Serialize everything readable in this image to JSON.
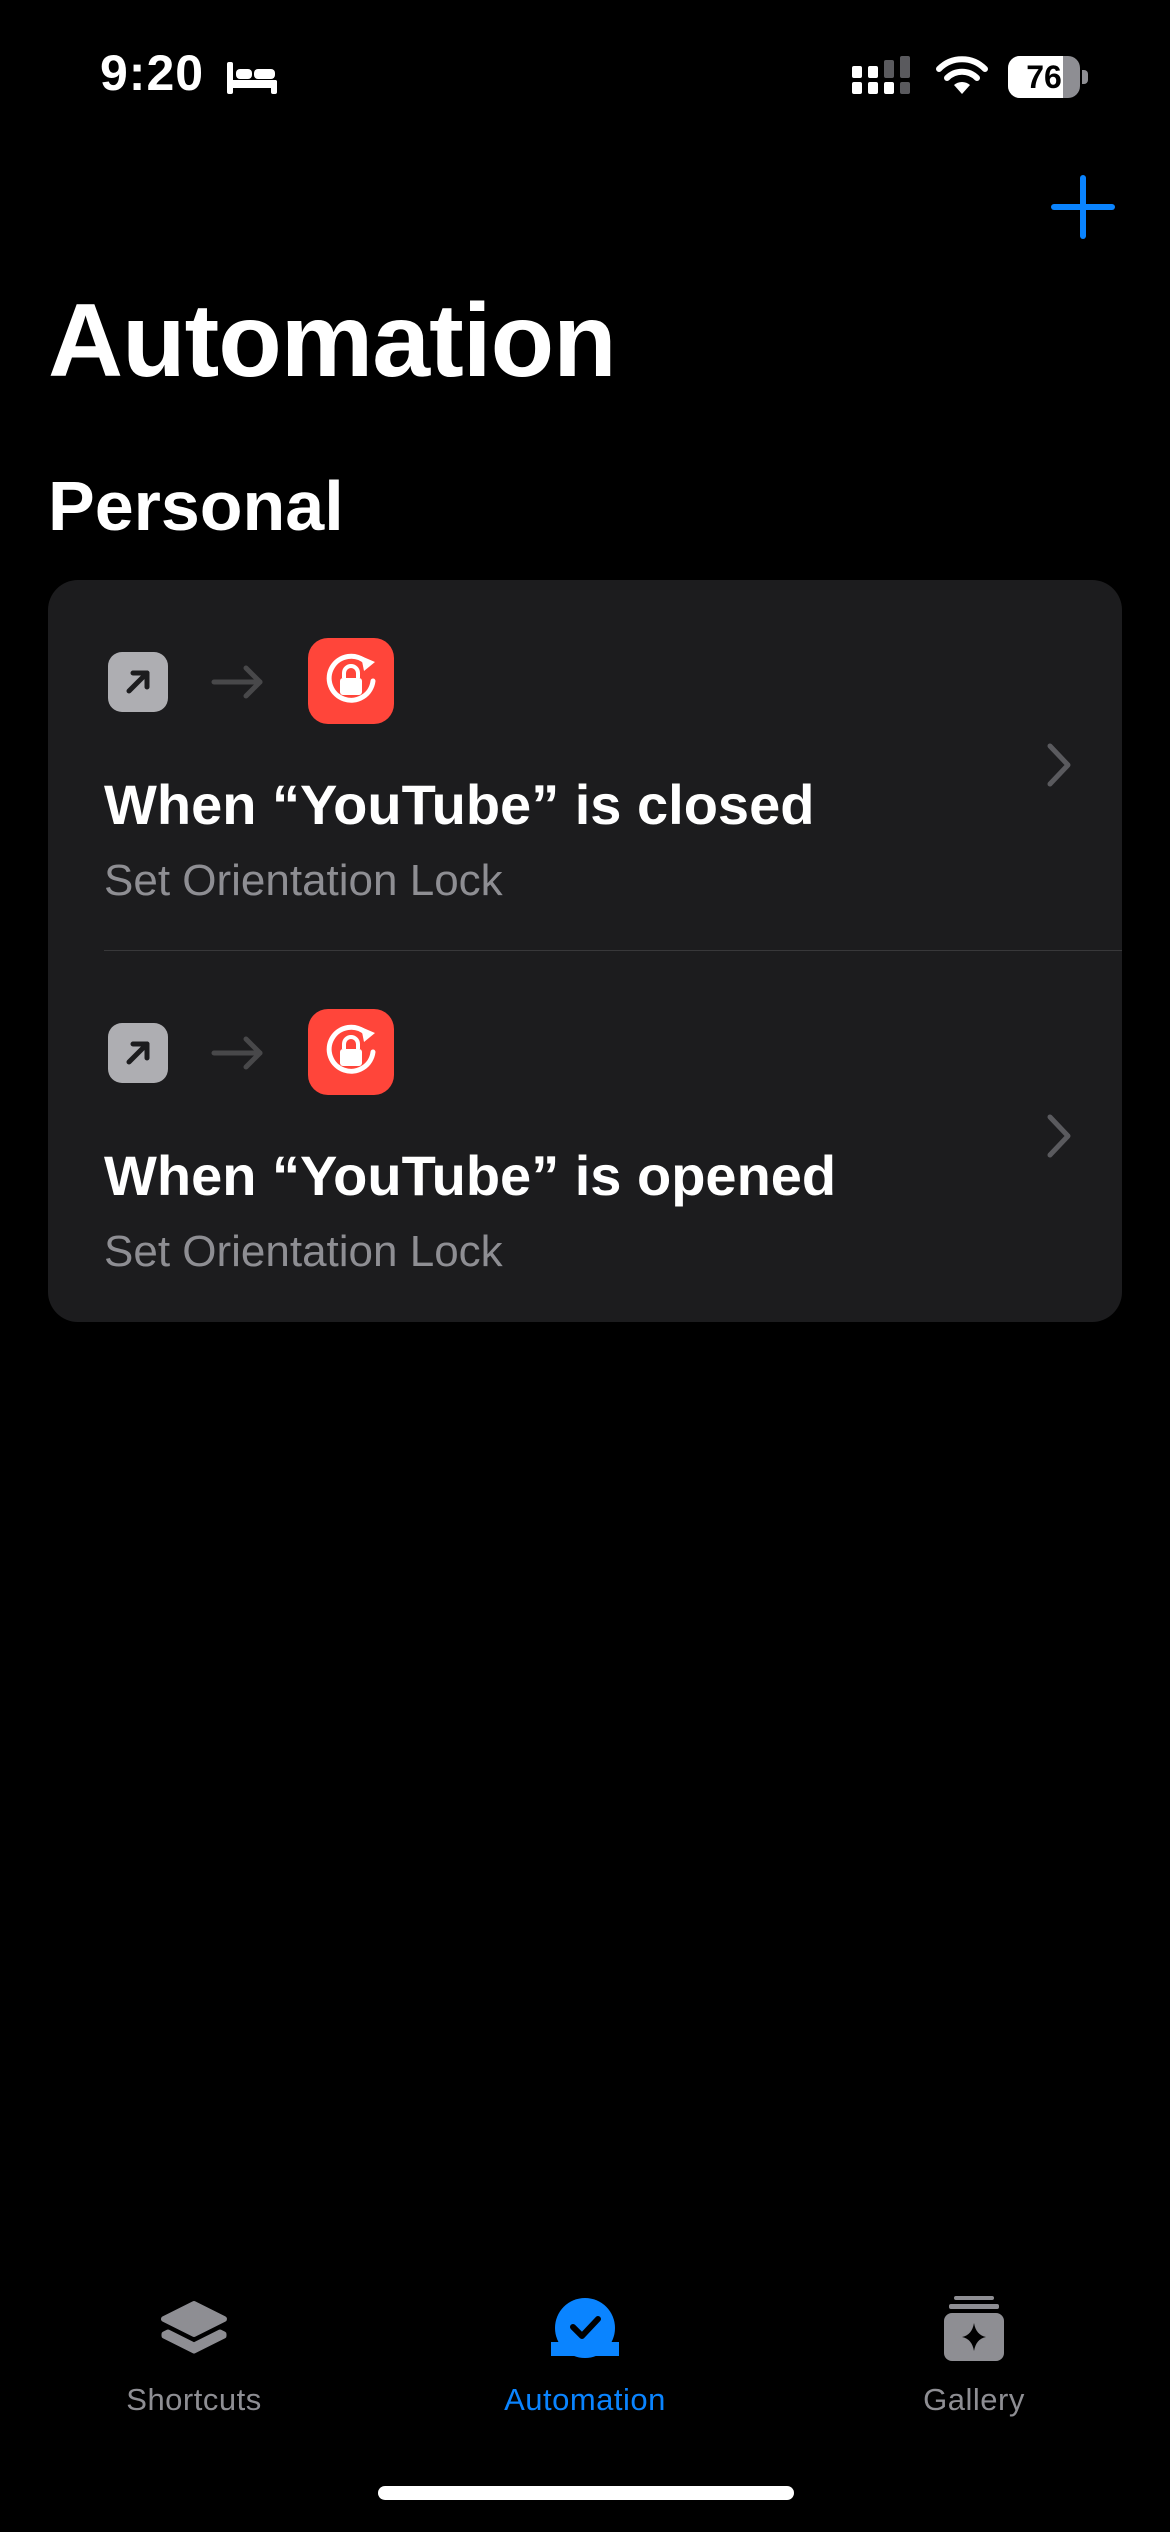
{
  "status_bar": {
    "time": "9:20",
    "battery_level": "76",
    "battery_fraction": 0.76
  },
  "header": {
    "add_icon": "plus-icon",
    "title": "Automation"
  },
  "section": {
    "title": "Personal"
  },
  "automations": [
    {
      "trigger_icon": "app-arrow-icon",
      "action_icon": "orientation-lock-icon",
      "title": "When “YouTube” is closed",
      "subtitle": "Set Orientation Lock"
    },
    {
      "trigger_icon": "app-arrow-icon",
      "action_icon": "orientation-lock-icon",
      "title": "When “YouTube” is opened",
      "subtitle": "Set Orientation Lock"
    }
  ],
  "tabs": [
    {
      "label": "Shortcuts",
      "icon": "layers-icon",
      "active": false
    },
    {
      "label": "Automation",
      "icon": "checkmark-circle-icon",
      "active": true
    },
    {
      "label": "Gallery",
      "icon": "sparkle-gallery-icon",
      "active": false
    }
  ],
  "colors": {
    "accent": "#0a84ff",
    "action_icon_bg": "#ff453a",
    "card_bg": "#1c1c1e",
    "secondary_text": "#8e8e93"
  }
}
